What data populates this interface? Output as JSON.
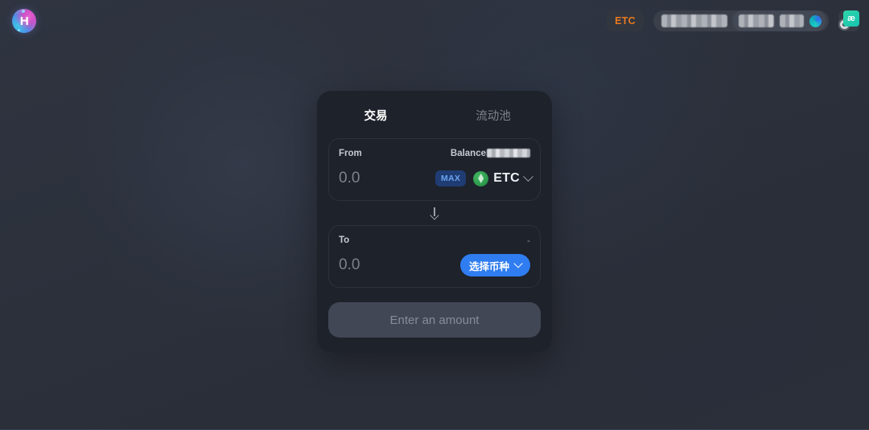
{
  "app": {
    "logo_letter": "H",
    "logo_name": "huckleberry-logo"
  },
  "topbar": {
    "network_badge": "ETC",
    "wallet_address_redacted": "",
    "wallet_balance_redacted": "",
    "extension_glyph": "æ"
  },
  "card": {
    "tabs": [
      {
        "label": "交易",
        "active": true
      },
      {
        "label": "流动池",
        "active": false
      }
    ],
    "from": {
      "label": "From",
      "balance_label": "Balance",
      "balance_value_redacted": "",
      "amount_placeholder": "0.0",
      "amount_value": "",
      "max_label": "MAX",
      "token_symbol": "ETC"
    },
    "to": {
      "label": "To",
      "rate_value": "-",
      "amount_placeholder": "0.0",
      "amount_value": "",
      "select_token_label": "选择币种"
    },
    "cta_label": "Enter an amount"
  },
  "colors": {
    "accent_blue": "#2f7df0",
    "max_blue": "#6ba4ef",
    "network_orange": "#e8791f",
    "token_green": "#2f9e4f",
    "card_bg": "#1e222a",
    "page_bg": "#2b2f39"
  }
}
